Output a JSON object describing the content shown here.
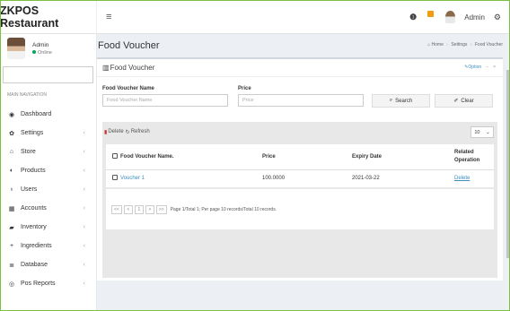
{
  "header": {
    "brand": "ZKPOS Restaurant",
    "menu_icon": "≡",
    "info_icon": "❶",
    "user_name": "Admin"
  },
  "sidebar": {
    "user_name": "Admin",
    "user_status": "Online",
    "nav_header": "MAIN NAVIGATION",
    "items": [
      {
        "label": "Dashboard",
        "icon": "tachometer-icon",
        "glyph": "◉",
        "has_children": false
      },
      {
        "label": "Settings",
        "icon": "gear-icon",
        "glyph": "✿",
        "has_children": true
      },
      {
        "label": "Store",
        "icon": "home-icon",
        "glyph": "⌂",
        "has_children": true
      },
      {
        "label": "Products",
        "icon": "lightbulb-icon",
        "glyph": "◐",
        "has_children": true
      },
      {
        "label": "Users",
        "icon": "user-icon",
        "glyph": "♁",
        "has_children": true
      },
      {
        "label": "Accounts",
        "icon": "calculator-icon",
        "glyph": "▦",
        "has_children": true
      },
      {
        "label": "Inventory",
        "icon": "truck-icon",
        "glyph": "▰",
        "has_children": true
      },
      {
        "label": "Ingredients",
        "icon": "plus-icon",
        "glyph": "+",
        "has_children": true
      },
      {
        "label": "Database",
        "icon": "database-icon",
        "glyph": "≣",
        "has_children": true
      },
      {
        "label": "Pos Reports",
        "icon": "eye-icon",
        "glyph": "◎",
        "has_children": true
      }
    ]
  },
  "page": {
    "title": "Food Voucher",
    "breadcrumb": [
      "Home",
      "Settings",
      "Food Voucher"
    ]
  },
  "box": {
    "title": "Food Voucher",
    "options_label": "Option",
    "minimize": "−",
    "close": "×"
  },
  "form": {
    "name_label": "Food Voucher Name",
    "name_placeholder": "Food Voucher Name",
    "price_label": "Price",
    "price_placeholder": "Price",
    "search_label": "Search",
    "clear_label": "Clear"
  },
  "grid": {
    "delete_label": "Delete",
    "refresh_label": "Refresh",
    "page_size": "10",
    "columns": [
      "Food Voucher Name.",
      "Price",
      "Expiry Date",
      "Related Operation"
    ],
    "rows": [
      {
        "name": "Voucher 1",
        "price": "100.0000",
        "expiry": "2021-03-22",
        "action": "Delete"
      }
    ],
    "pager": {
      "first": "<<",
      "prev": "<",
      "page": "1",
      "next": ">",
      "last": ">>",
      "info": "Page 1/Total 1; Per page 10 records/Total 10 records."
    }
  }
}
